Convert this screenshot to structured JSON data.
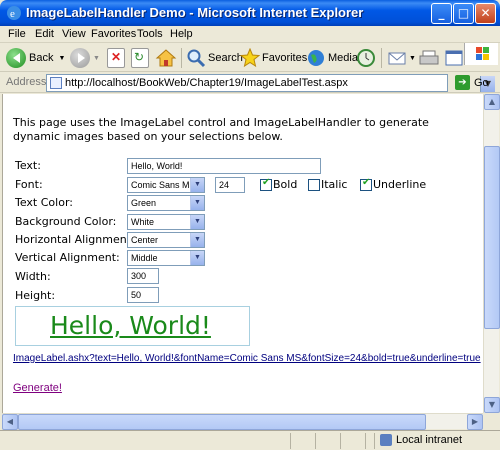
{
  "window": {
    "title": "ImageLabelHandler Demo - Microsoft Internet Explorer"
  },
  "menu": [
    "File",
    "Edit",
    "View",
    "Favorites",
    "Tools",
    "Help"
  ],
  "toolbar": {
    "back": "Back",
    "search": "Search",
    "favorites": "Favorites",
    "media": "Media"
  },
  "address": {
    "label": "Address",
    "url": "http://localhost/BookWeb/Chapter19/ImageLabelTest.aspx",
    "go": "Go"
  },
  "page": {
    "intro": "This page uses the ImageLabel control and ImageLabelHandler to generate dynamic images based on your selections below.",
    "labels": {
      "text": "Text:",
      "font": "Font:",
      "text_color": "Text Color:",
      "background_color": "Background Color:",
      "horizontal_alignment": "Horizontal Alignment:",
      "vertical_alignment": "Vertical Alignment:",
      "width": "Width:",
      "height": "Height:"
    },
    "values": {
      "text": "Hello, World!",
      "font_name": "Comic Sans MS",
      "font_size": "24",
      "text_color": "Green",
      "background_color": "White",
      "horizontal_alignment": "Center",
      "vertical_alignment": "Middle",
      "width": "300",
      "height": "50"
    },
    "style_options": [
      {
        "label": "Bold",
        "checked": true
      },
      {
        "label": "Italic",
        "checked": false
      },
      {
        "label": "Underline",
        "checked": true
      }
    ],
    "preview_text": "Hello, World!",
    "preview_color": "#1a8a1a",
    "image_link": "ImageLabel.ashx?text=Hello, World!&fontName=Comic Sans MS&fontSize=24&bold=true&underline=true",
    "generate": "Generate!"
  },
  "status": {
    "zone": "Local intranet"
  }
}
